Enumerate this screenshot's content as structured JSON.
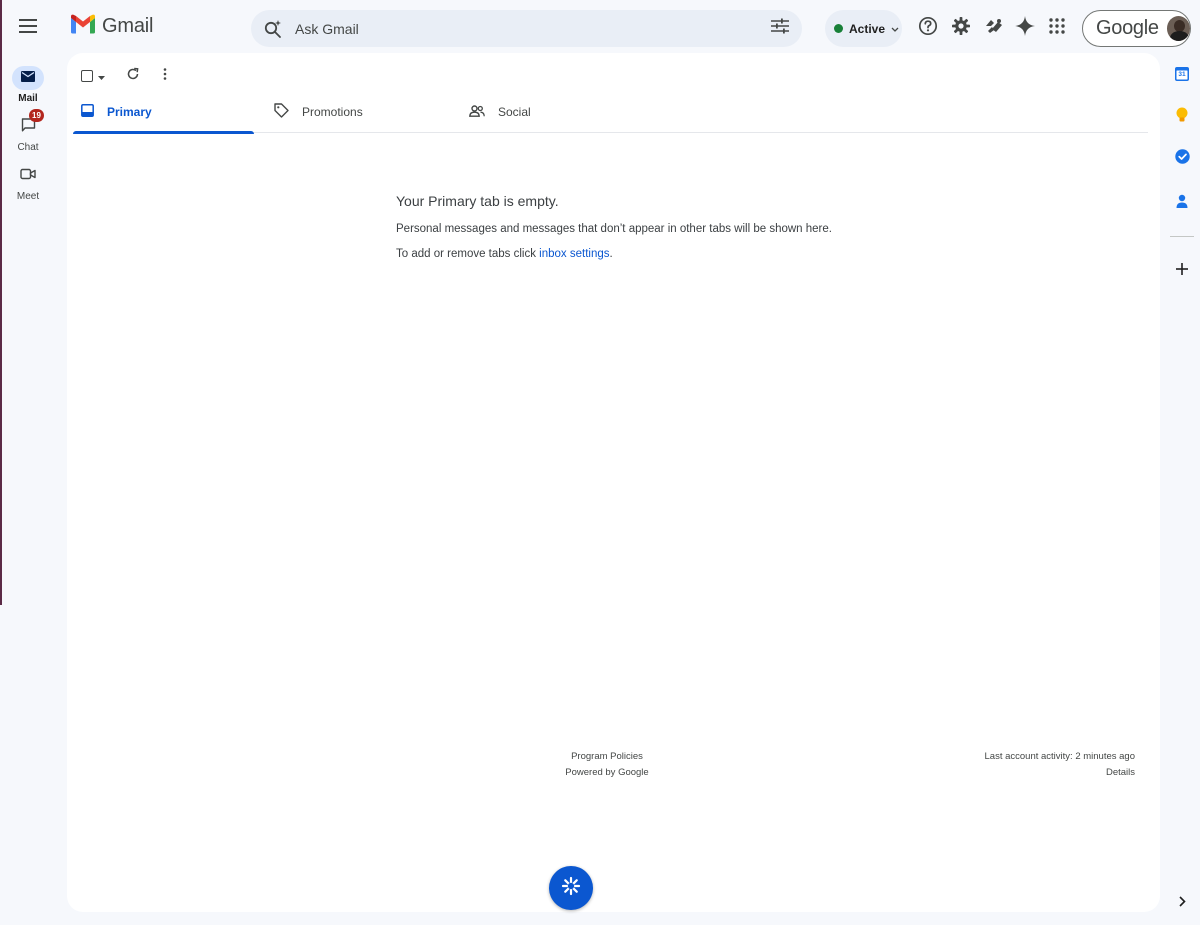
{
  "app": {
    "logo_text": "Gmail"
  },
  "search": {
    "placeholder": "Ask Gmail"
  },
  "status": {
    "label": "Active",
    "color": "#188038"
  },
  "account": {
    "brand": "Google"
  },
  "leftnav": {
    "items": [
      {
        "label": "Mail",
        "icon": "mail-icon",
        "active": true
      },
      {
        "label": "Chat",
        "icon": "chat-icon",
        "badge": "19"
      },
      {
        "label": "Meet",
        "icon": "video-icon"
      }
    ]
  },
  "tabs": [
    {
      "label": "Primary",
      "icon": "inbox-icon",
      "active": true
    },
    {
      "label": "Promotions",
      "icon": "tag-icon"
    },
    {
      "label": "Social",
      "icon": "people-icon"
    }
  ],
  "empty": {
    "title": "Your Primary tab is empty.",
    "line1": "Personal messages and messages that don’t appear in other tabs will be shown here.",
    "line2_prefix": "To add or remove tabs click ",
    "line2_link": "inbox settings",
    "line2_suffix": "."
  },
  "footer": {
    "program_policies": "Program Policies",
    "powered_by": "Powered by Google",
    "last_activity": "Last account activity: 2 minutes ago",
    "details": "Details"
  },
  "rightrail": {
    "calendar_day": "31",
    "icons": [
      "calendar-icon",
      "keep-icon",
      "tasks-icon",
      "contacts-icon",
      "add-icon",
      "expand-icon"
    ]
  },
  "colors": {
    "accent": "#0b57d0",
    "background": "#f6f8fc",
    "badge": "#b3261e"
  }
}
